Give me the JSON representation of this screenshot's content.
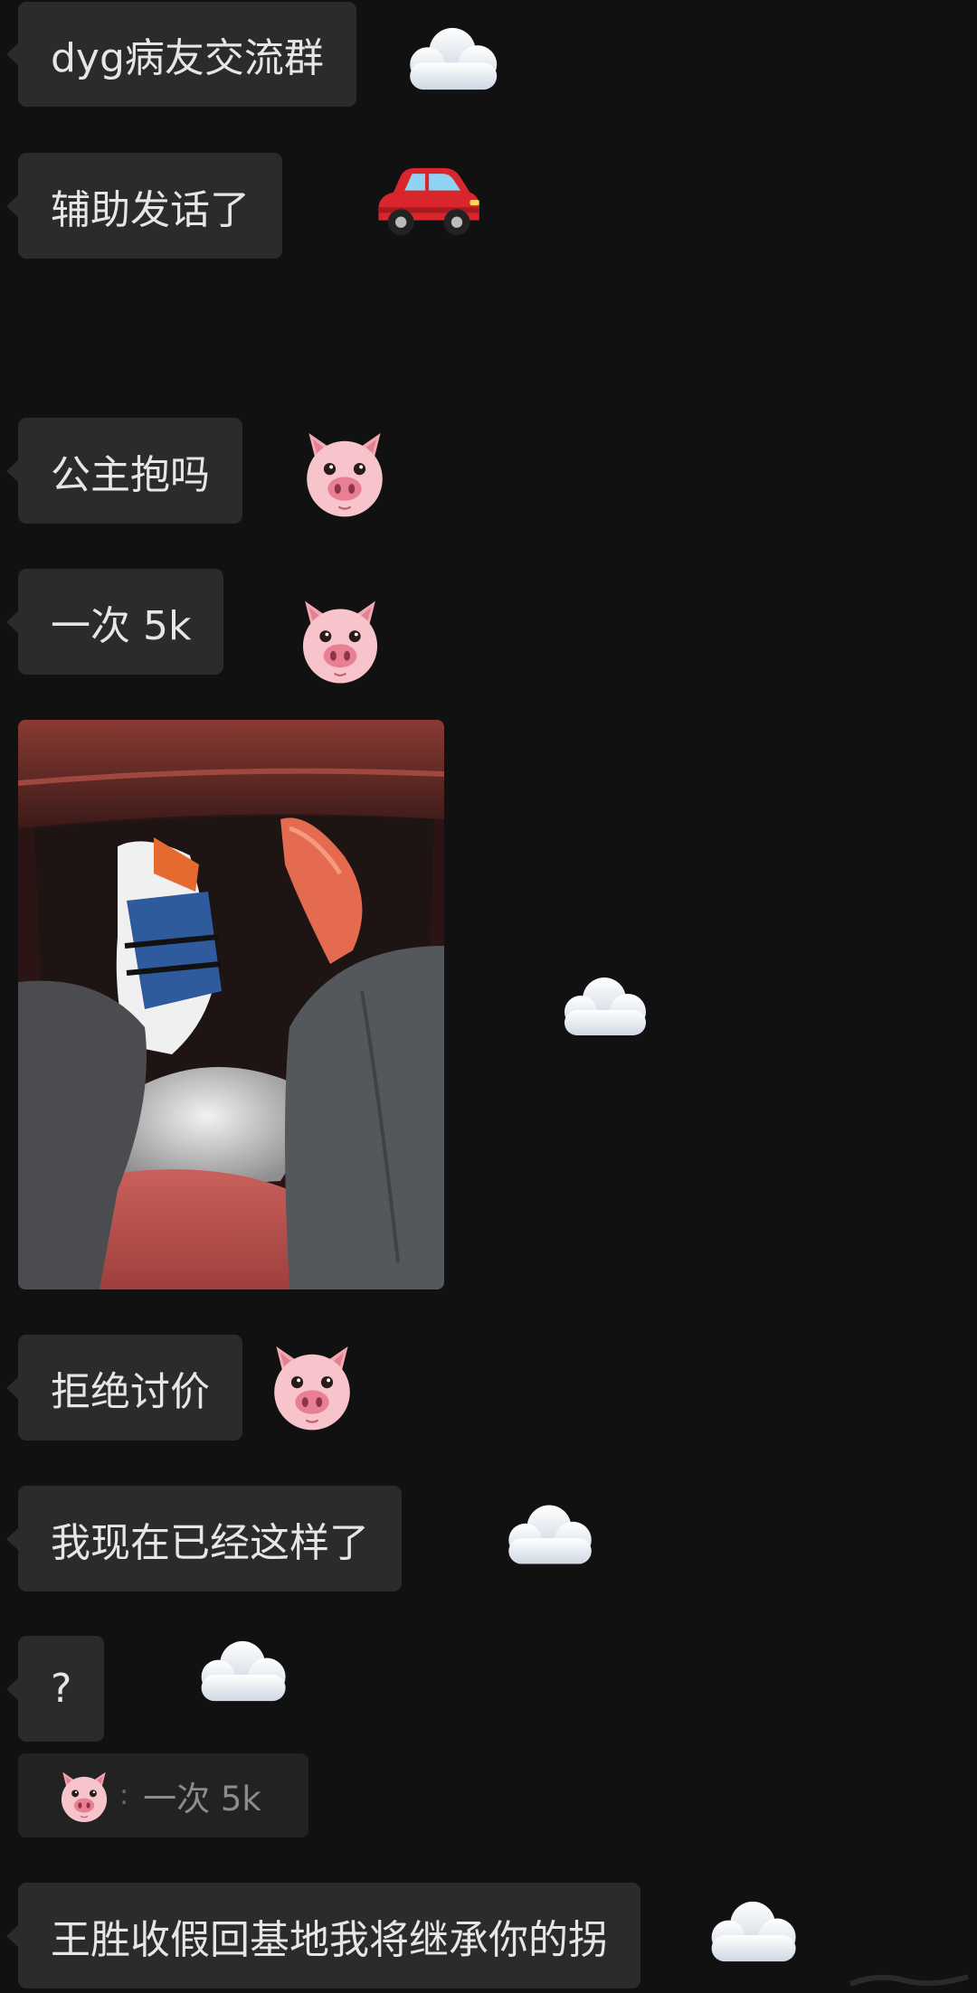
{
  "messages": [
    {
      "text": "dyg病友交流群",
      "avatar": "cloud-emoji"
    },
    {
      "text": "辅助发话了",
      "avatar": "car-emoji"
    },
    {
      "text": "公主抱吗",
      "avatar": "pig-emoji"
    },
    {
      "text": "一次 5k",
      "avatar": "pig-emoji"
    },
    {
      "image": "photo-of-legs-in-car",
      "avatar": "cloud-emoji"
    },
    {
      "text": "拒绝讨价",
      "avatar": "pig-emoji"
    },
    {
      "text": "我现在已经这样了",
      "avatar": "cloud-emoji"
    },
    {
      "text": "?",
      "avatar": "cloud-emoji"
    },
    {
      "text": "王胜收假回基地我将继承你的拐",
      "avatar": "cloud-emoji"
    }
  ],
  "reply_quote": {
    "avatar": "pig-emoji",
    "separator": ":",
    "text": "一次 5k"
  },
  "colors": {
    "background": "#111111",
    "bubble": "#2b2b2b",
    "bubble_text": "#e6e6e6",
    "quote_bg": "#222222",
    "quote_text": "#8c8c8c"
  }
}
